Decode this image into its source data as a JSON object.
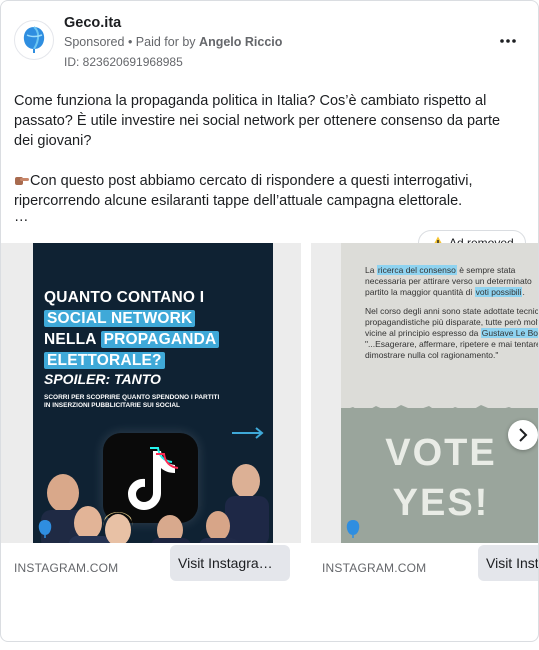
{
  "post": {
    "page_name": "Geco.ita",
    "sponsored_label": "Sponsored",
    "paid_prefix": "• Paid for by",
    "payer": "Angelo Riccio",
    "library_id": "ID: 823620691968985",
    "body_paragraph_1": "Come funziona la propaganda politica in Italia? Cos’è cambiato rispetto al passato? È utile investire nei social network per ottenere consenso da parte dei giovani?",
    "body_paragraph_2": "Con questo post abbiamo cercato di rispondere a questi interrogativi, ripercorrendo alcune esilaranti tappe dell’attuale campagna elettorale.",
    "truncation": "…",
    "ad_removed_label": "Ad removed",
    "point_emoji_icon": "pointing-finger-icon"
  },
  "cards": [
    {
      "headline_1": "QUANTO CONTANO I",
      "headline_2": "SOCIAL NETWORK",
      "headline_3": "NELLA",
      "headline_3b": "PROPAGANDA",
      "headline_4": "ELETTORALE?",
      "spoiler": "SPOILER: TANTO",
      "subtext": "SCORRI PER SCOPRIRE QUANTO SPENDONO I PARTITI IN INSERZIONI PUBBLICITARIE SUI SOCIAL",
      "domain": "INSTAGRAM.COM",
      "cta": "Visit Instagram profile"
    },
    {
      "p1_a": "La",
      "p1_hl": "ricerca del consenso",
      "p1_b": "è sempre stata necessaria per attirare verso un determinato partito la maggior quantità di",
      "p1_hl2": "voti possibili",
      "p2_a": "Nel corso degli anni sono state adottate tecniche propagandistiche più disparate, tutte però molto vicine al principio espresso da",
      "p2_hl": "Gustave Le Bon",
      "p2_b": ": \"...Esagerare, affermare, ripetere e mai tentare di dimostrare nulla col ragionamento.\"",
      "vote_line_1": "VOTE",
      "vote_line_2": "YES!",
      "domain": "INSTAGRAM.COM",
      "cta": "Visit Instagram profile"
    }
  ],
  "colors": {
    "accent_blue": "#3fa9d8",
    "dark_navy": "#0f2233",
    "muted_text": "#65676b"
  }
}
